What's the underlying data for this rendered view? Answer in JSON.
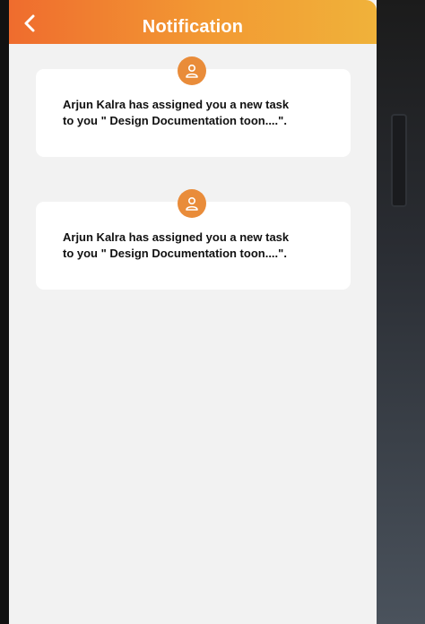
{
  "header": {
    "title": "Notification",
    "back_icon": "chevron-left-icon"
  },
  "notifications": [
    {
      "message": "Arjun Kalra has assigned you a new task to you \" Design Documentation toon....\".",
      "avatar_icon": "user-icon"
    },
    {
      "message": "Arjun Kalra has assigned you a new task to you \" Design Documentation toon....\".",
      "avatar_icon": "user-icon"
    }
  ],
  "colors": {
    "header_gradient_start": "#ef6c2e",
    "header_gradient_end": "#f0b23a",
    "avatar": "#e98c3a",
    "background": "#f2f2f2",
    "card": "#ffffff"
  }
}
